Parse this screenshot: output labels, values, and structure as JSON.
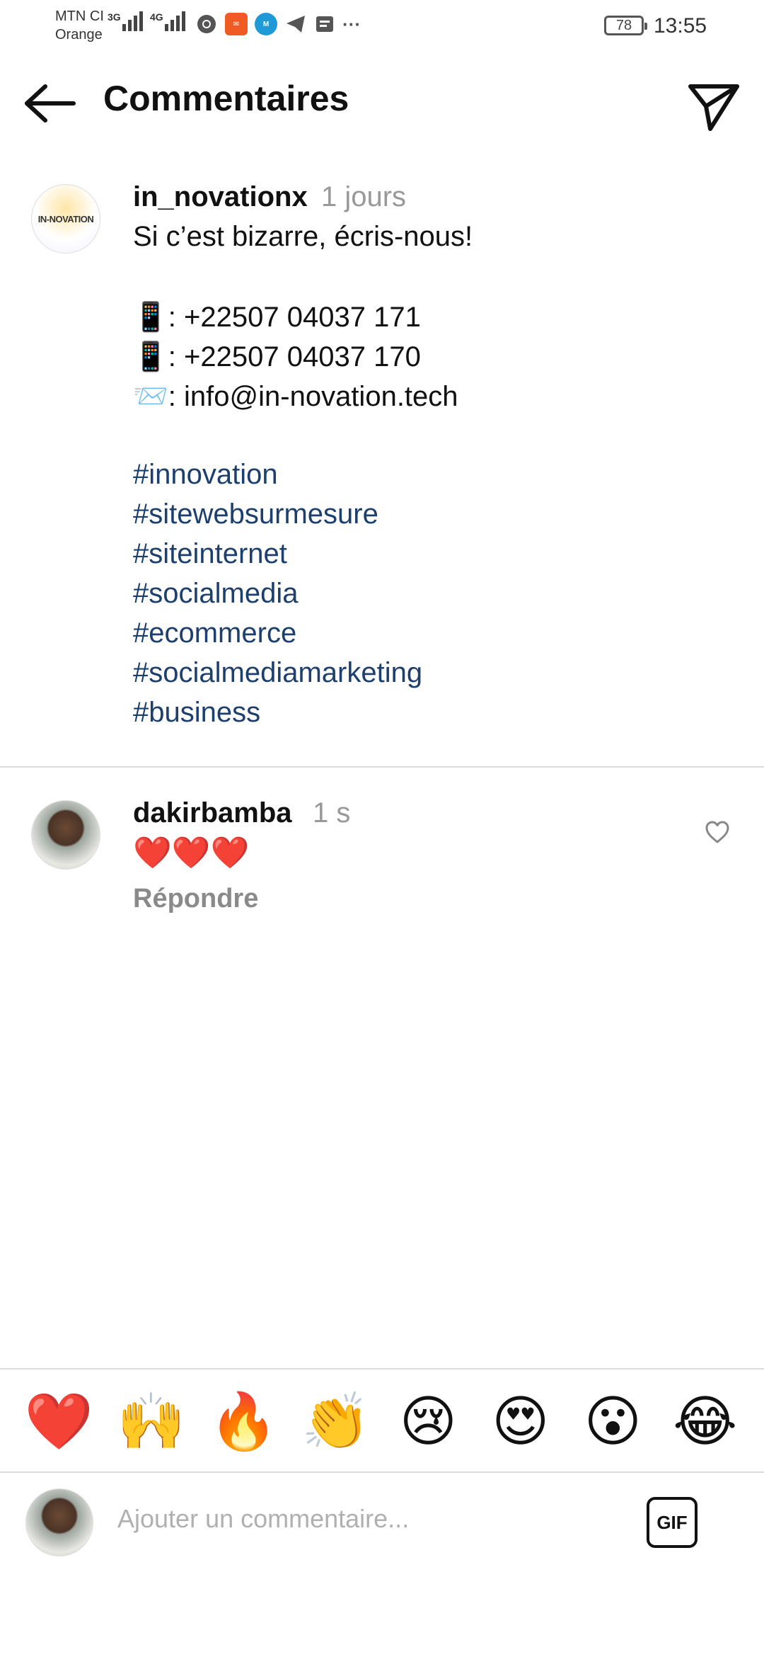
{
  "status_bar": {
    "carrier_1": "MTN CI",
    "carrier_2": "Orange",
    "net_1": "3G",
    "net_2": "4G",
    "battery": "78",
    "time": "13:55",
    "more": "···"
  },
  "header": {
    "title": "Commentaires"
  },
  "post": {
    "username": "in_novationx",
    "time": "1 jours",
    "avatar_text": "IN-NOVATION",
    "line1": "Si c’est bizarre, écris-nous!",
    "contact_1": "📱: +22507 04037 171",
    "contact_2": "📱: +22507 04037 170",
    "contact_3": "📨: info@in-novation.tech",
    "hashtags": [
      "#innovation",
      "#sitewebsurmesure",
      "#siteinternet",
      "#socialmedia",
      "#ecommerce",
      "#socialmediamarketing",
      "#business"
    ]
  },
  "comment": {
    "username": "dakirbamba",
    "time": "1 s",
    "text": "❤️❤️❤️",
    "reply_label": "Répondre"
  },
  "emoji_bar": [
    "❤️",
    "🙌",
    "🔥",
    "👏",
    "😢",
    "😍",
    "😮",
    "😂"
  ],
  "composer": {
    "placeholder": "Ajouter un commentaire...",
    "gif_label": "GIF"
  }
}
